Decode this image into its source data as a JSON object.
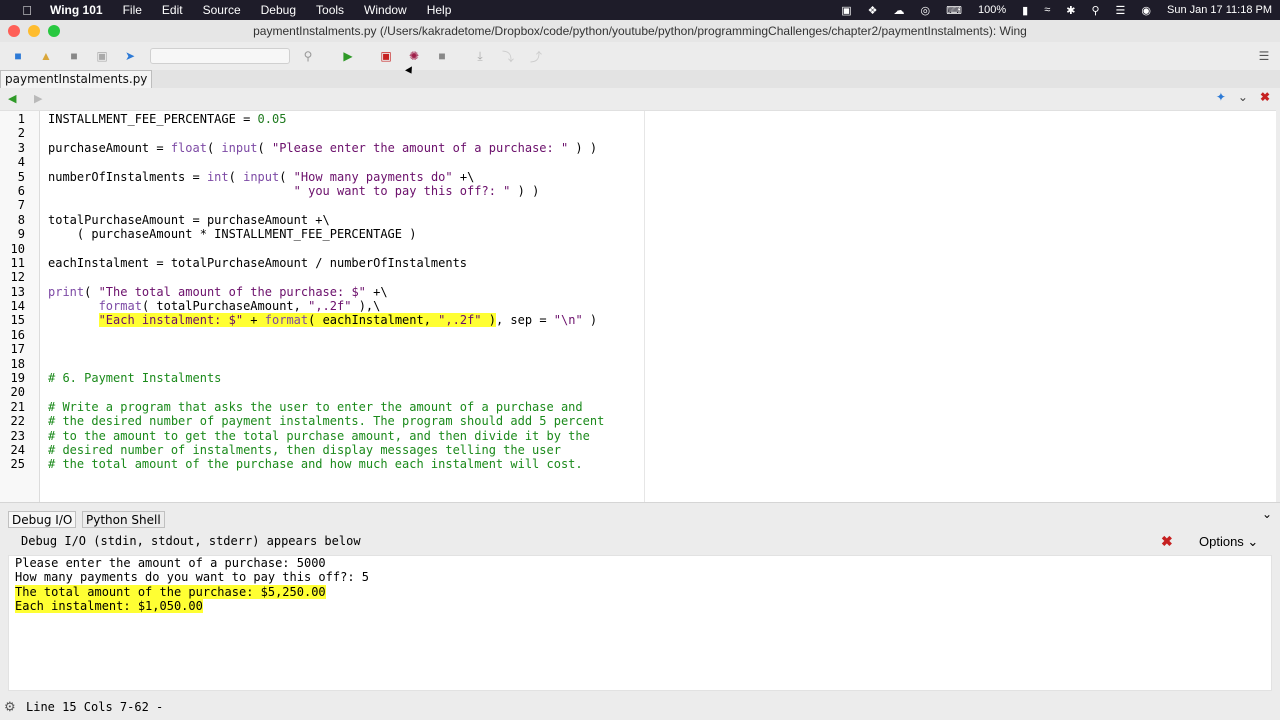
{
  "menubar": {
    "app": "Wing 101",
    "items": [
      "File",
      "Edit",
      "Source",
      "Debug",
      "Tools",
      "Window",
      "Help"
    ],
    "status": {
      "battery": "100%",
      "datetime": "Sun Jan 17  11:18 PM"
    }
  },
  "window": {
    "title": "paymentInstalments.py (/Users/kakradetome/Dropbox/code/python/youtube/python/programmingChallenges/chapter2/paymentInstalments): Wing"
  },
  "editor": {
    "tab": "paymentInstalments.py",
    "lines": [
      {
        "n": "1",
        "t": "INSTALLMENT_FEE_PERCENTAGE = 0.05"
      },
      {
        "n": "2",
        "t": ""
      },
      {
        "n": "3",
        "t": "purchaseAmount = float( input( \"Please enter the amount of a purchase: \" ) )"
      },
      {
        "n": "4",
        "t": ""
      },
      {
        "n": "5",
        "t": "numberOfInstalments = int( input( \"How many payments do\" +\\"
      },
      {
        "n": "6",
        "t": "                                  \" you want to pay this off?: \" ) )"
      },
      {
        "n": "7",
        "t": ""
      },
      {
        "n": "8",
        "t": "totalPurchaseAmount = purchaseAmount +\\"
      },
      {
        "n": "9",
        "t": "    ( purchaseAmount * INSTALLMENT_FEE_PERCENTAGE )"
      },
      {
        "n": "10",
        "t": ""
      },
      {
        "n": "11",
        "t": "eachInstalment = totalPurchaseAmount / numberOfInstalments"
      },
      {
        "n": "12",
        "t": ""
      },
      {
        "n": "13",
        "t": "print( \"The total amount of the purchase: $\" +\\"
      },
      {
        "n": "14",
        "t": "       format( totalPurchaseAmount, \",.2f\" ),\\"
      },
      {
        "n": "15",
        "t": "       \"Each instalment: $\" + format( eachInstalment, \",.2f\" ), sep = \"\\n\" )"
      },
      {
        "n": "16",
        "t": ""
      },
      {
        "n": "17",
        "t": ""
      },
      {
        "n": "18",
        "t": ""
      },
      {
        "n": "19",
        "t": "# 6. Payment Instalments"
      },
      {
        "n": "20",
        "t": ""
      },
      {
        "n": "21",
        "t": "# Write a program that asks the user to enter the amount of a purchase and"
      },
      {
        "n": "22",
        "t": "# the desired number of payment instalments. The program should add 5 percent"
      },
      {
        "n": "23",
        "t": "# to the amount to get the total purchase amount, and then divide it by the"
      },
      {
        "n": "24",
        "t": "# desired number of instalments, then display messages telling the user"
      },
      {
        "n": "25",
        "t": "# the total amount of the purchase and how much each instalment will cost."
      }
    ]
  },
  "bottom": {
    "tabs": [
      "Debug I/O",
      "Python Shell"
    ],
    "header": "Debug I/O (stdin, stdout, stderr) appears below",
    "options": "Options",
    "output": [
      "Please enter the amount of a purchase: 5000",
      "How many payments do you want to pay this off?: 5",
      "The total amount of the purchase: $5,250.00",
      "Each instalment: $1,050.00"
    ]
  },
  "status": {
    "text": "Line 15 Cols 7-62 -"
  },
  "colors": {
    "highlight": "#ffff33",
    "run": "#2f9a28",
    "close": "#c62121",
    "menubar": "#1e1c29"
  }
}
